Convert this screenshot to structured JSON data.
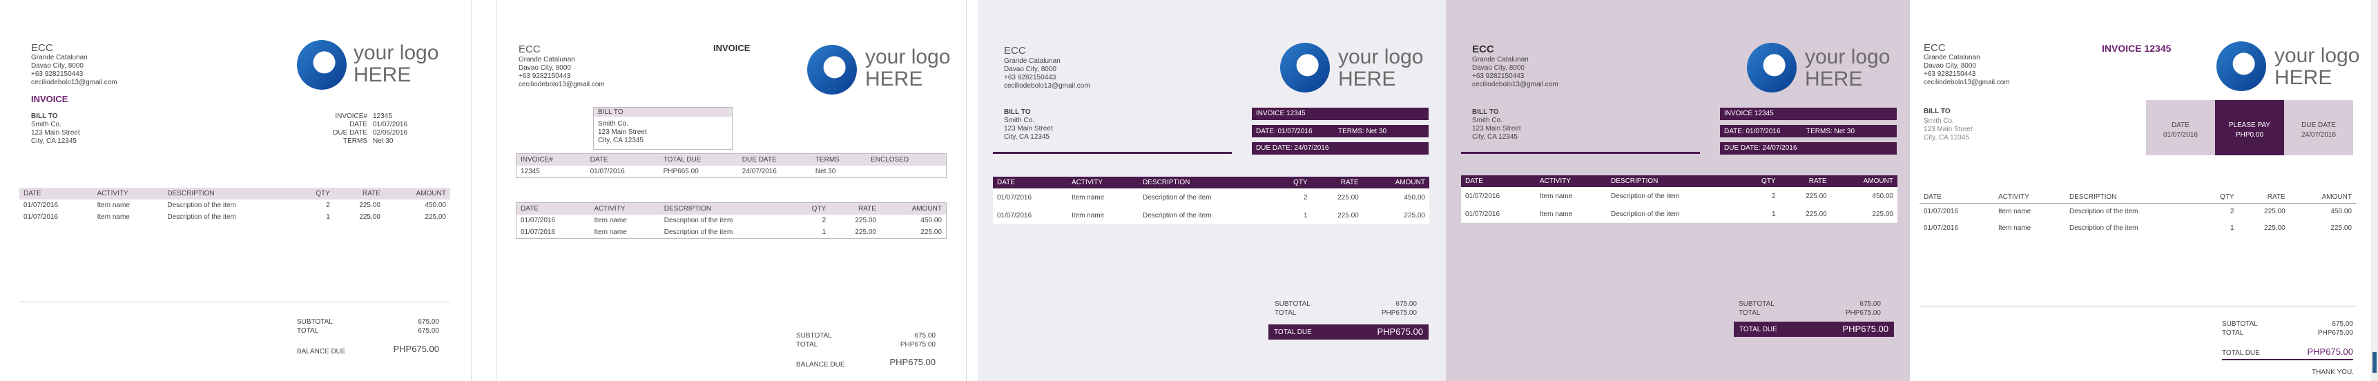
{
  "company": {
    "name": "ECC",
    "address": [
      "Grande Catalunan",
      "Davao City, 8000",
      "+63 9282150443",
      "ceciliodebolo13@gmail.com"
    ],
    "logo_line1": "your logo",
    "logo_line2": "HERE"
  },
  "bill_to": {
    "label": "BILL TO",
    "lines": [
      "Smith Co.",
      "123 Main Street",
      "City, CA 12345"
    ]
  },
  "invoice": {
    "title": "INVOICE",
    "title_with_num": "INVOICE 12345",
    "number_label": "INVOICE#",
    "number": "12345",
    "date_label": "DATE",
    "date": "01/07/2016",
    "due_label": "DUE DATE",
    "due": "02/06/2016",
    "due_alt": "24/07/2016",
    "terms_label": "TERMS",
    "terms": "Net 30",
    "total_due_label": "TOTAL DUE",
    "total_due": "PHP665.00",
    "enclosed_label": "ENCLOSED",
    "please_pay_label": "PLEASE PAY",
    "please_pay": "PHP0.00",
    "band_invoice": "INVOICE 12345",
    "band_date": "DATE: 01/07/2016",
    "band_terms": "TERMS: Net 30",
    "band_due": "DUE DATE: 24/07/2016"
  },
  "items_header": {
    "date": "DATE",
    "activity": "ACTIVITY",
    "description": "DESCRIPTION",
    "qty": "QTY",
    "rate": "RATE",
    "amount": "AMOUNT"
  },
  "items": [
    {
      "date": "01/07/2016",
      "activity": "Item name",
      "description": "Description of the item",
      "qty": "2",
      "rate": "225.00",
      "amount": "450.00"
    },
    {
      "date": "01/07/2016",
      "activity": "Item name",
      "description": "Description of the item",
      "qty": "1",
      "rate": "225.00",
      "amount": "225.00"
    }
  ],
  "totals": {
    "subtotal_label": "SUBTOTAL",
    "subtotal": "675.00",
    "total_label": "TOTAL",
    "total": "675.00",
    "total_php": "PHP675.00",
    "balance_label": "BALANCE DUE",
    "balance": "PHP675.00",
    "total_due_label": "TOTAL DUE",
    "total_due": "PHP675.00",
    "thank_you": "THANK YOU."
  },
  "colors": {
    "purple": "#4a1a4c",
    "lilac": "#d9ccd9",
    "panel3_bg": "#eeedf2",
    "panel4_bg": "#d8ccd8"
  }
}
